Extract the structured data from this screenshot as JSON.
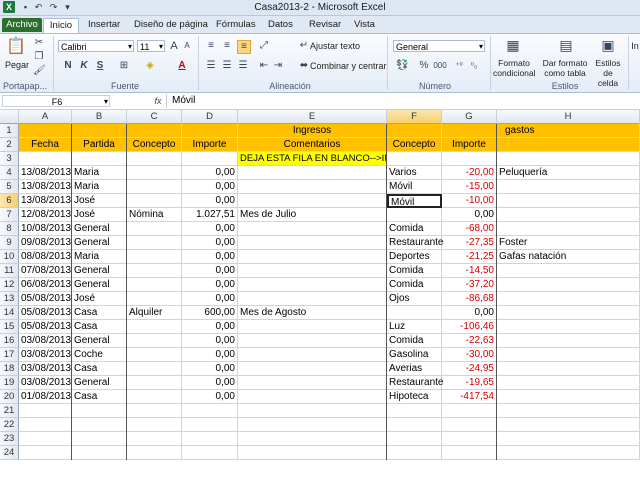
{
  "window": {
    "title": "Casa2013-2  -  Microsoft Excel"
  },
  "quick_access": [
    "save-icon",
    "undo-icon",
    "redo-icon",
    "customize-icon"
  ],
  "tabs": {
    "archivo": "Archivo",
    "inicio": "Inicio",
    "insertar": "Insertar",
    "diseno": "Diseño de página",
    "formulas": "Fórmulas",
    "datos": "Datos",
    "revisar": "Revisar",
    "vista": "Vista"
  },
  "ribbon": {
    "clipboard": {
      "paste": "Pegar",
      "label": "Portapap..."
    },
    "font": {
      "name": "Calibri",
      "size": "11",
      "bold": "N",
      "italic": "K",
      "underline": "S",
      "label": "Fuente"
    },
    "alignment": {
      "wrap": "Ajustar texto",
      "merge": "Combinar y centrar",
      "label": "Alineación"
    },
    "number": {
      "format": "General",
      "percent": "%",
      "thousands": "000",
      "label": "Número"
    },
    "styles": {
      "cond": "Formato condicional",
      "table": "Dar formato como tabla",
      "cell": "Estilos de celda",
      "label": "Estilos"
    },
    "insert_cut": "In"
  },
  "formula_bar": {
    "name_box": "F6",
    "fx": "fx",
    "value": "Móvil"
  },
  "columns": [
    "A",
    "B",
    "C",
    "D",
    "E",
    "F",
    "G",
    "H"
  ],
  "row_numbers": [
    "1",
    "2",
    "3",
    "4",
    "5",
    "6",
    "7",
    "8",
    "9",
    "10",
    "11",
    "12",
    "13",
    "14",
    "15",
    "16",
    "17",
    "18",
    "19",
    "20",
    "21",
    "22",
    "23",
    "24"
  ],
  "header": {
    "ingresos": "Ingresos",
    "gastos": "gastos",
    "fecha": "Fecha",
    "partida": "Partida",
    "concepto": "Concepto",
    "importe": "Importe",
    "comentarios": "Comentarios",
    "concepto2": "Concepto",
    "importe2": "Importe",
    "note": "DEJA ESTA FILA EN BLANCO-->IMP"
  },
  "rows": [
    {
      "fecha": "13/08/2013",
      "partida": "Maria",
      "concepto": "",
      "importe": "0,00",
      "comentario": "",
      "gconcepto": "Varios",
      "gimporte": "-20,00",
      "h": "Peluquería"
    },
    {
      "fecha": "13/08/2013",
      "partida": "Maria",
      "concepto": "",
      "importe": "0,00",
      "comentario": "",
      "gconcepto": "Móvil",
      "gimporte": "-15,00",
      "h": ""
    },
    {
      "fecha": "13/08/2013",
      "partida": "José",
      "concepto": "",
      "importe": "0,00",
      "comentario": "",
      "gconcepto": "Móvil",
      "gimporte": "-10,00",
      "h": ""
    },
    {
      "fecha": "12/08/2013",
      "partida": "José",
      "concepto": "Nómina",
      "importe": "1.027,51",
      "comentario": "Mes de Julio",
      "gconcepto": "",
      "gimporte": "0,00",
      "h": ""
    },
    {
      "fecha": "10/08/2013",
      "partida": "General",
      "concepto": "",
      "importe": "0,00",
      "comentario": "",
      "gconcepto": "Comida",
      "gimporte": "-68,00",
      "h": ""
    },
    {
      "fecha": "09/08/2013",
      "partida": "General",
      "concepto": "",
      "importe": "0,00",
      "comentario": "",
      "gconcepto": "Restaurante",
      "gimporte": "-27,35",
      "h": "Foster"
    },
    {
      "fecha": "08/08/2013",
      "partida": "Maria",
      "concepto": "",
      "importe": "0,00",
      "comentario": "",
      "gconcepto": "Deportes",
      "gimporte": "-21,25",
      "h": "Gafas natación"
    },
    {
      "fecha": "07/08/2013",
      "partida": "General",
      "concepto": "",
      "importe": "0,00",
      "comentario": "",
      "gconcepto": "Comida",
      "gimporte": "-14,50",
      "h": ""
    },
    {
      "fecha": "06/08/2013",
      "partida": "General",
      "concepto": "",
      "importe": "0,00",
      "comentario": "",
      "gconcepto": "Comida",
      "gimporte": "-37,20",
      "h": ""
    },
    {
      "fecha": "05/08/2013",
      "partida": "José",
      "concepto": "",
      "importe": "0,00",
      "comentario": "",
      "gconcepto": "Ojos",
      "gimporte": "-86,68",
      "h": ""
    },
    {
      "fecha": "05/08/2013",
      "partida": "Casa",
      "concepto": "Alquiler",
      "importe": "600,00",
      "comentario": "Mes de Agosto",
      "gconcepto": "",
      "gimporte": "0,00",
      "h": ""
    },
    {
      "fecha": "05/08/2013",
      "partida": "Casa",
      "concepto": "",
      "importe": "0,00",
      "comentario": "",
      "gconcepto": "Luz",
      "gimporte": "-106,46",
      "h": ""
    },
    {
      "fecha": "03/08/2013",
      "partida": "General",
      "concepto": "",
      "importe": "0,00",
      "comentario": "",
      "gconcepto": "Comida",
      "gimporte": "-22,63",
      "h": ""
    },
    {
      "fecha": "03/08/2013",
      "partida": "Coche",
      "concepto": "",
      "importe": "0,00",
      "comentario": "",
      "gconcepto": "Gasolina",
      "gimporte": "-30,00",
      "h": ""
    },
    {
      "fecha": "03/08/2013",
      "partida": "Casa",
      "concepto": "",
      "importe": "0,00",
      "comentario": "",
      "gconcepto": "Averias",
      "gimporte": "-24,95",
      "h": ""
    },
    {
      "fecha": "03/08/2013",
      "partida": "General",
      "concepto": "",
      "importe": "0,00",
      "comentario": "",
      "gconcepto": "Restaurante",
      "gimporte": "-19,65",
      "h": ""
    },
    {
      "fecha": "01/08/2013",
      "partida": "Casa",
      "concepto": "",
      "importe": "0,00",
      "comentario": "",
      "gconcepto": "Hipoteca",
      "gimporte": "-417,54",
      "h": ""
    }
  ],
  "colors": {
    "header_fill": "#ffc000",
    "note_fill": "#ffff00",
    "negative": "#d40000",
    "archivo_tab": "#2a6f2e"
  }
}
